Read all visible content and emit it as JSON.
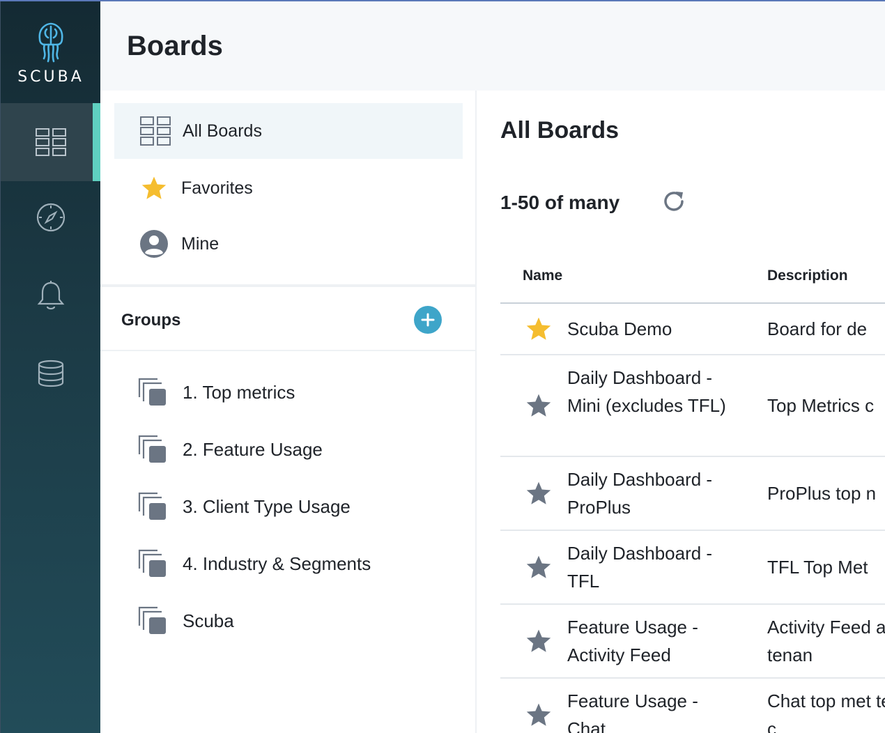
{
  "brand": {
    "name": "SCUBA",
    "logo_color": "#4fb6e6"
  },
  "rail": {
    "items": [
      {
        "icon": "boards-grid-icon",
        "active": true
      },
      {
        "icon": "compass-icon",
        "active": false
      },
      {
        "icon": "bell-icon",
        "active": false
      },
      {
        "icon": "database-icon",
        "active": false
      }
    ],
    "accent": "#5fd0c0"
  },
  "header": {
    "title": "Boards"
  },
  "nav": {
    "items": [
      {
        "label": "All Boards",
        "icon": "boards-grid-icon",
        "selected": true
      },
      {
        "label": "Favorites",
        "icon": "star-icon",
        "selected": false
      },
      {
        "label": "Mine",
        "icon": "user-icon",
        "selected": false
      }
    ],
    "groups_title": "Groups",
    "groups": [
      {
        "label": "1. Top metrics"
      },
      {
        "label": "2. Feature Usage"
      },
      {
        "label": "3. Client Type Usage"
      },
      {
        "label": "4. Industry & Segments"
      },
      {
        "label": "Scuba"
      }
    ]
  },
  "main": {
    "title": "All Boards",
    "count": "1-50 of many",
    "columns": {
      "name": "Name",
      "description": "Description"
    },
    "rows": [
      {
        "name": "Scuba Demo",
        "description": "Board for de",
        "favorite": true
      },
      {
        "name": "Daily Dashboard - Mini (excludes TFL)",
        "description": "Top Metrics c",
        "favorite": false
      },
      {
        "name": "Daily Dashboard - ProPlus",
        "description": "ProPlus top n",
        "favorite": false
      },
      {
        "name": "Daily Dashboard - TFL",
        "description": "TFL Top Met",
        "favorite": false
      },
      {
        "name": "Feature Usage - Activity Feed",
        "description": "Activity Feed across tenan",
        "favorite": false
      },
      {
        "name": "Feature Usage - Chat",
        "description": "Chat top met tenants and c",
        "favorite": false
      }
    ]
  },
  "colors": {
    "star_favorite": "#f5bd2f",
    "star_default": "#6b7583",
    "add_button": "#3ea5c9"
  }
}
